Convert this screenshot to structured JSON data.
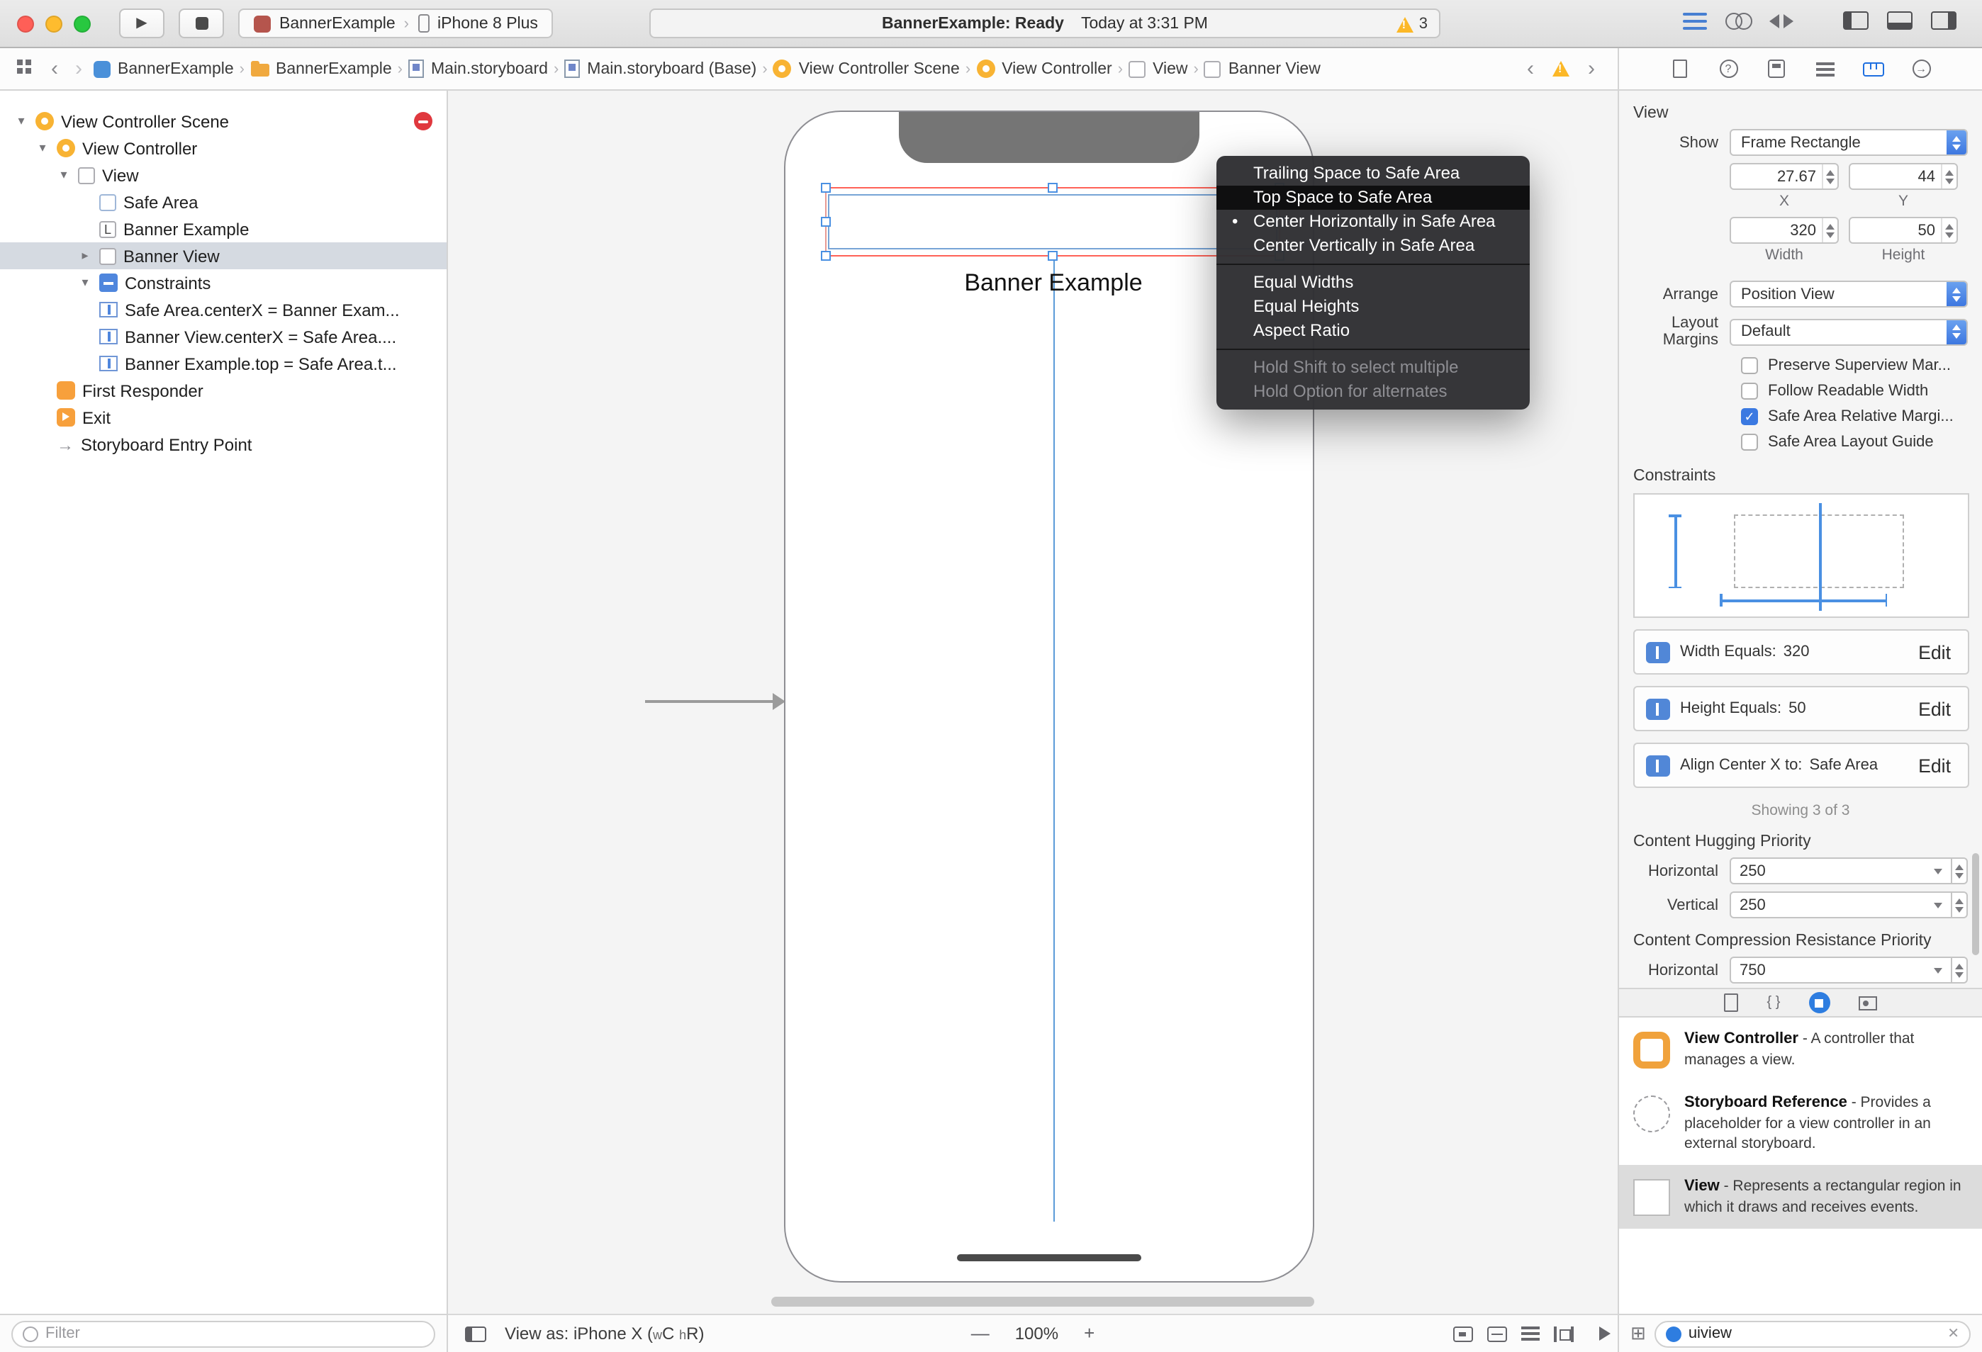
{
  "icons": {
    "play": "▶",
    "back": "‹",
    "forward": "›",
    "crumb_sep": "›",
    "disclosure_open": "▾",
    "disclosure_closed": "▸",
    "warning_mark": "!",
    "label_glyph": "L",
    "entry_arrow": "→",
    "menu_bullet": "•",
    "check": "✓",
    "zoom_out": "—",
    "zoom_in": "+",
    "grid": "⊞",
    "braces": "{ }",
    "help": "?",
    "connections": "→",
    "clear": "✕"
  },
  "toolbar": {
    "scheme_name": "BannerExample",
    "device_name": "iPhone 8 Plus",
    "status_primary": "BannerExample: Ready",
    "status_secondary": "Today at 3:31 PM",
    "warning_count": "3"
  },
  "jumpbar": {
    "crumbs": [
      "BannerExample",
      "BannerExample",
      "Main.storyboard",
      "Main.storyboard (Base)",
      "View Controller Scene",
      "View Controller",
      "View",
      "Banner View"
    ]
  },
  "outline": {
    "rows": [
      {
        "label": "View Controller Scene",
        "level": 0,
        "icon": "scene",
        "disclosure": "open",
        "badge": "error"
      },
      {
        "label": "View Controller",
        "level": 1,
        "icon": "view-controller",
        "disclosure": "open"
      },
      {
        "label": "View",
        "level": 2,
        "icon": "view",
        "disclosure": "open"
      },
      {
        "label": "Safe Area",
        "level": 3,
        "icon": "safe-area"
      },
      {
        "label": "Banner Example",
        "level": 3,
        "icon": "label"
      },
      {
        "label": "Banner View",
        "level": 3,
        "icon": "view",
        "disclosure": "closed",
        "selected": true
      },
      {
        "label": "Constraints",
        "level": 3,
        "icon": "constraints-group",
        "disclosure": "open"
      },
      {
        "label": "Safe Area.centerX = Banner Exam...",
        "level": 4,
        "icon": "constraint"
      },
      {
        "label": "Banner View.centerX = Safe Area....",
        "level": 4,
        "icon": "constraint"
      },
      {
        "label": "Banner Example.top = Safe Area.t...",
        "level": 4,
        "icon": "constraint"
      },
      {
        "label": "First Responder",
        "level": 1,
        "icon": "first-responder"
      },
      {
        "label": "Exit",
        "level": 1,
        "icon": "exit"
      },
      {
        "label": "Storyboard Entry Point",
        "level": 1,
        "icon": "entry-arrow"
      }
    ],
    "filter_placeholder": "Filter"
  },
  "canvas": {
    "banner_label": "Banner Example",
    "view_as_prefix": "View as: iPhone X (",
    "trait_w": "w",
    "trait_c": "C",
    "trait_h": "h",
    "trait_r": "R",
    "view_as_suffix": ")",
    "zoom_level": "100%"
  },
  "context_menu": {
    "items": [
      {
        "label": "Trailing Space to Safe Area",
        "state": "normal"
      },
      {
        "label": "Top Space to Safe Area",
        "state": "highlighted"
      },
      {
        "label": "Center Horizontally in Safe Area",
        "state": "bulleted"
      },
      {
        "label": "Center Vertically in Safe Area",
        "state": "normal"
      },
      {
        "label": "Equal Widths",
        "state": "normal"
      },
      {
        "label": "Equal Heights",
        "state": "normal"
      },
      {
        "label": "Aspect Ratio",
        "state": "normal"
      },
      {
        "label": "Hold Shift to select multiple",
        "state": "disabled"
      },
      {
        "label": "Hold Option for alternates",
        "state": "disabled"
      }
    ]
  },
  "inspector": {
    "title": "View",
    "show_label": "Show",
    "show_value": "Frame Rectangle",
    "x_value": "27.67",
    "y_value": "44",
    "x_label": "X",
    "y_label": "Y",
    "width_value": "320",
    "height_value": "50",
    "width_label": "Width",
    "height_label": "Height",
    "arrange_label": "Arrange",
    "arrange_value": "Position View",
    "layout_margins_label": "Layout Margins",
    "layout_margins_value": "Default",
    "checkboxes": [
      {
        "label": "Preserve Superview Mar...",
        "checked": false
      },
      {
        "label": "Follow Readable Width",
        "checked": false
      },
      {
        "label": "Safe Area Relative Margi...",
        "checked": true
      },
      {
        "label": "Safe Area Layout Guide",
        "checked": false
      }
    ],
    "constraints_title": "Constraints",
    "constraint_rows": [
      {
        "label": "Width Equals:",
        "value": "320",
        "action": "Edit"
      },
      {
        "label": "Height Equals:",
        "value": "50",
        "action": "Edit"
      },
      {
        "label": "Align Center X to:",
        "value": "Safe Area",
        "action": "Edit"
      }
    ],
    "showing_text": "Showing 3 of 3",
    "hugging_title": "Content Hugging Priority",
    "hugging_rows": [
      {
        "label": "Horizontal",
        "value": "250"
      },
      {
        "label": "Vertical",
        "value": "250"
      }
    ],
    "compression_title": "Content Compression Resistance Priority",
    "compression_rows": [
      {
        "label": "Horizontal",
        "value": "750"
      }
    ]
  },
  "library": {
    "items": [
      {
        "title": "View Controller",
        "description": "- A controller that manages a view.",
        "selected": false
      },
      {
        "title": "Storyboard Reference",
        "description": "- Provides a placeholder for a view controller in an external storyboard.",
        "selected": false
      },
      {
        "title": "View",
        "description": "- Represents a rectangular region in which it draws and receives events.",
        "selected": true
      }
    ],
    "filter_value": "uiview"
  }
}
